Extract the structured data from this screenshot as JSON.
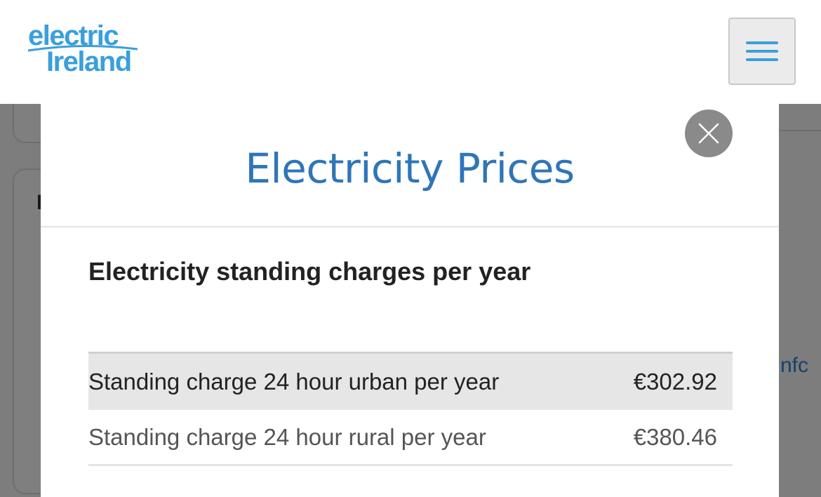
{
  "header": {
    "logo_line1": "electric",
    "logo_line2": "Ireland",
    "logo_color": "#3a9fdc",
    "menu_icon": "hamburger-icon"
  },
  "background": {
    "partial_letter": "I",
    "partial_link": "nfc"
  },
  "modal": {
    "title": "Electricity Prices",
    "close_icon": "close-icon",
    "section_heading": "Electricity standing charges per year",
    "rows": [
      {
        "label": "Standing charge 24 hour urban per year",
        "value": "€302.92"
      },
      {
        "label": "Standing charge 24 hour rural per year",
        "value": "€380.46"
      }
    ]
  },
  "colors": {
    "title_blue": "#2f75b8",
    "accent_blue": "#3a9fdc",
    "overlay": "#7d7d7d"
  }
}
